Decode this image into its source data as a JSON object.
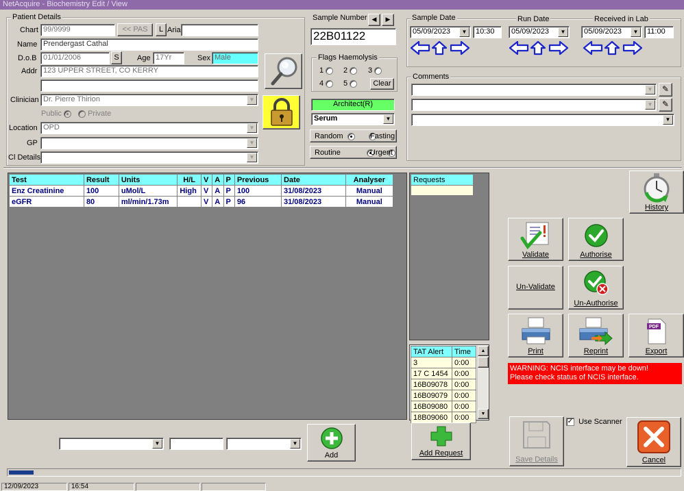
{
  "window": {
    "title": "NetAcquire - Biochemistry Edit / View"
  },
  "patient": {
    "legend": "Patient Details",
    "chart_label": "Chart",
    "chart_value": "99/9999",
    "pas_button": "<< PAS",
    "l_button": "L",
    "aria_label": "Aria",
    "aria_value": "",
    "name_label": "Name",
    "name_value": "Prendergast Cathal",
    "dob_label": "D.o.B",
    "dob_value": "01/01/2006",
    "s_button": "S",
    "age_label": "Age",
    "age_value": "17Yr",
    "sex_label": "Sex",
    "sex_value": "Male",
    "addr_label": "Addr",
    "addr_value1": "123 UPPER STREET, CO KERRY",
    "addr_value2": "",
    "clinician_label": "Clinician",
    "clinician_value": "Dr. Pierre Thirion",
    "public_label": "Public",
    "private_label": "Private",
    "location_label": "Location",
    "location_value": "OPD",
    "gp_label": "GP",
    "gp_value": "",
    "cl_label": "Cl Details",
    "cl_value": ""
  },
  "sample": {
    "number_label": "Sample Number",
    "number_value": "22B01122",
    "flags_legend": "Flags Haemolysis",
    "flag_labels": [
      "1",
      "2",
      "3",
      "4",
      "5"
    ],
    "clear_button": "Clear",
    "analyser": "Architect(R)",
    "sample_type": "Serum",
    "random_label": "Random",
    "fasting_label": "Fasting",
    "routine_label": "Routine",
    "urgent_label": "Urgent"
  },
  "dates": {
    "sample_date_label": "Sample Date",
    "sample_date": "05/09/2023",
    "sample_time": "10:30",
    "run_date_label": "Run Date",
    "run_date": "05/09/2023",
    "received_label": "Received in Lab",
    "received_date": "05/09/2023",
    "received_time": "11:00"
  },
  "comments": {
    "legend": "Comments",
    "line1": "",
    "line2": "",
    "line3": ""
  },
  "results": {
    "headers": [
      "Test",
      "Result",
      "Units",
      "H/L",
      "V",
      "A",
      "P",
      "Previous",
      "Date",
      "Analyser"
    ],
    "rows": [
      [
        "Enz Creatinine",
        "100",
        "uMol/L",
        "High",
        "V",
        "A",
        "P",
        "100",
        "31/08/2023",
        "Manual"
      ],
      [
        "eGFR",
        "80",
        "ml/min/1.73m",
        "",
        "V",
        "A",
        "P",
        "96",
        "31/08/2023",
        "Manual"
      ]
    ]
  },
  "requests": {
    "header": "Requests"
  },
  "tat": {
    "headers": [
      "TAT Alert",
      "Time"
    ],
    "rows": [
      [
        "3",
        "0:00"
      ],
      [
        "17 C 1454",
        "0:00"
      ],
      [
        "16B09078",
        "0:00"
      ],
      [
        "16B09079",
        "0:00"
      ],
      [
        "16B09080",
        "0:00"
      ],
      [
        "18B09060",
        "0:00"
      ]
    ]
  },
  "actions": {
    "history": "History",
    "validate": "Validate",
    "authorise": "Authorise",
    "unvalidate": "Un-Validate",
    "unauthorise": "Un-Authorise",
    "print": "Print",
    "reprint": "Reprint",
    "export": "Export",
    "add": "Add",
    "add_request": "Add Request",
    "save_details": "Save Details",
    "cancel": "Cancel",
    "use_scanner": "Use Scanner",
    "pdf_badge": "PDF"
  },
  "warning": {
    "line1": "WARNING: NCIS interface may be down!",
    "line2": "Please check status of NCIS interface."
  },
  "status": {
    "date": "12/09/2023",
    "time": "16:54"
  },
  "colors": {
    "window_bg": "#d4d0c8",
    "title_bg": "#8e6aa8",
    "grid_header": "#80ffff",
    "analyser_green": "#66ff66",
    "sex_highlight": "#66ffff",
    "warning_red": "#ff0000",
    "progress_blue": "#1c3c8c",
    "arrow_blue": "#1a24c8"
  }
}
